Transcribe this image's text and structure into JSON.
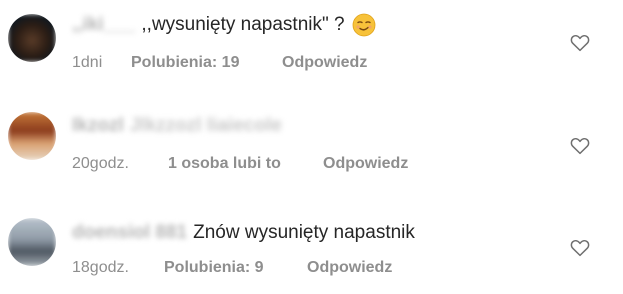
{
  "comments": [
    {
      "username": ",,iki___",
      "text": ",,wysunięty napastnik\" ?",
      "emoji": "smirk-emoji",
      "time": "1dni",
      "likes": "Polubienia: 19",
      "reply": "Odpowiedz"
    },
    {
      "username": "Ikzozl",
      "redacted": "Jlkzzozl liaiecole",
      "text": "",
      "time": "20godz.",
      "likes": "1 osoba lubi to",
      "reply": "Odpowiedz"
    },
    {
      "username": "doensiol 881",
      "text": "Znów wysunięty napastnik",
      "time": "18godz.",
      "likes": "Polubienia: 9",
      "reply": "Odpowiedz"
    }
  ],
  "icons": {
    "heart": "heart-outline-icon"
  },
  "colors": {
    "text": "#262626",
    "meta": "#8e8e8e",
    "background": "#ffffff"
  }
}
